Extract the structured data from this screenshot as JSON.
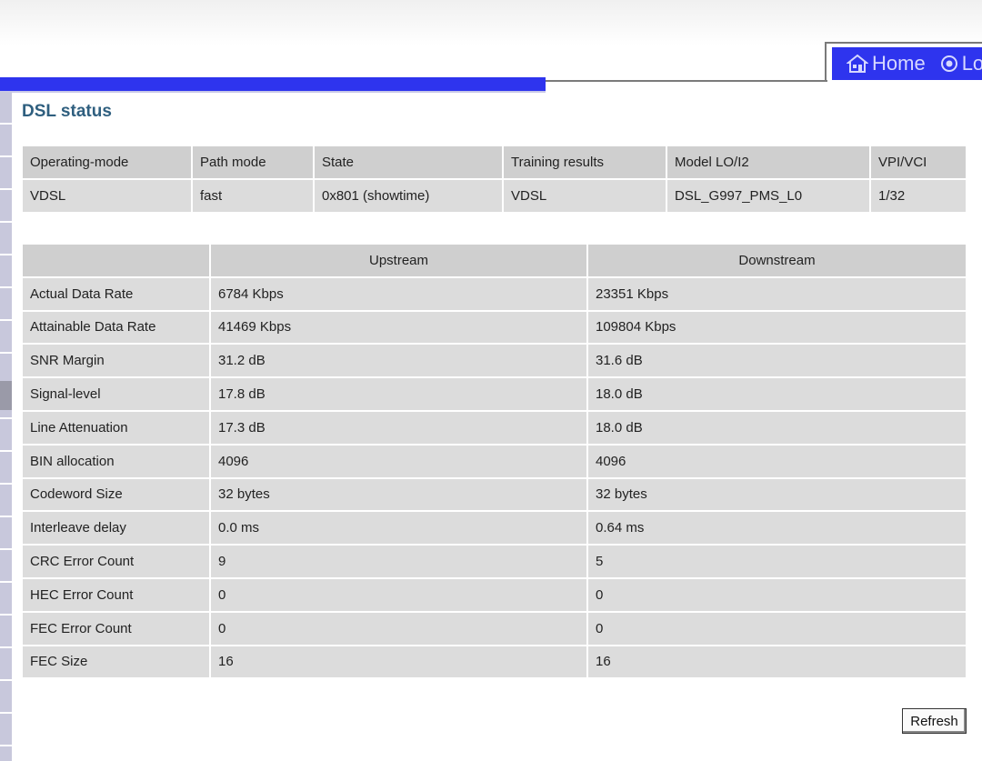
{
  "nav": {
    "home_label": "Home",
    "second_label": "Lo"
  },
  "page": {
    "title": "DSL status"
  },
  "info_table": {
    "headers": [
      "Operating-mode",
      "Path mode",
      "State",
      "Training results",
      "Model LO/I2",
      "VPI/VCI"
    ],
    "row": [
      "VDSL",
      "fast",
      "0x801 (showtime)",
      "VDSL",
      "DSL_G997_PMS_L0",
      "1/32"
    ]
  },
  "stats_table": {
    "headers": [
      "",
      "Upstream",
      "Downstream"
    ],
    "rows": [
      [
        "Actual Data Rate",
        "6784 Kbps",
        "23351 Kbps"
      ],
      [
        "Attainable Data Rate",
        "41469 Kbps",
        "109804 Kbps"
      ],
      [
        "SNR Margin",
        "31.2 dB",
        "31.6 dB"
      ],
      [
        "Signal-level",
        "17.8 dB",
        "18.0 dB"
      ],
      [
        "Line Attenuation",
        "17.3 dB",
        "18.0 dB"
      ],
      [
        "BIN allocation",
        "4096",
        "4096"
      ],
      [
        "Codeword Size",
        "32 bytes",
        "32 bytes"
      ],
      [
        "Interleave delay",
        "0.0 ms",
        "0.64 ms"
      ],
      [
        "CRC Error Count",
        "9",
        "5"
      ],
      [
        "HEC Error Count",
        "0",
        "0"
      ],
      [
        "FEC Error Count",
        "0",
        "0"
      ],
      [
        "FEC Size",
        "16",
        "16"
      ]
    ]
  },
  "actions": {
    "refresh_label": "Refresh"
  },
  "icons": {
    "home": "house-icon",
    "second": "circle-dot-icon"
  },
  "colors": {
    "nav_blue": "#2e34ee",
    "title": "#2f5f7f",
    "cell": "#dcdcdc"
  }
}
